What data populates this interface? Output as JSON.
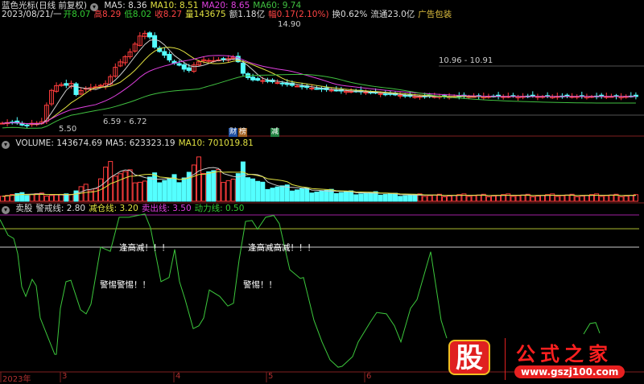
{
  "header": {
    "title": "蓝色光标(日线 前复权)",
    "ma5": "MA5: 8.36",
    "ma10": "MA10: 8.51",
    "ma20": "MA20: 8.65",
    "ma60": "MA60: 9.74",
    "date": "2023/08/21/一",
    "open_l": "开",
    "open": "8.07",
    "high_l": "高",
    "high": "8.29",
    "low_l": "低",
    "low": "8.02",
    "close_l": "收",
    "close": "8.27",
    "vol_l": "量",
    "vol": "143675",
    "amt": "额1.18亿",
    "chg_l": "幅",
    "chg": "0.17(2.10%)",
    "turn": "换0.62%",
    "float": "流通23.0亿",
    "sector": "广告包装"
  },
  "price_labels": {
    "high": "14.90",
    "low": "5.50",
    "range1": "6.59 - 6.72",
    "range2": "10.96 - 10.91"
  },
  "tags": {
    "cai": "财",
    "bang": "榜",
    "jian": "减"
  },
  "volume_header": {
    "vol": "VOLUME: 143674.69",
    "ma5": "MA5: 623323.19",
    "ma10": "MA10: 701019.81"
  },
  "indicator_header": {
    "name": "卖股",
    "warn": "警戒线: 2.80",
    "reduce": "减仓线: 3.20",
    "sell": "卖出线: 3.50",
    "power": "动力线: 0.50"
  },
  "annotations": [
    "逢高减！！！",
    "逢高减高减！！！",
    "警惕警惕！！",
    "警惕！！"
  ],
  "xaxis": [
    "2023年",
    "3",
    "4",
    "5",
    "6"
  ],
  "watermark": {
    "logo": "股",
    "name": "公式之家",
    "url": "www.gszj100.com"
  },
  "colors": {
    "up": "#ff3c3c",
    "down": "#54ffff",
    "ma5": "#cccccc",
    "ma10": "#e0e040",
    "ma20": "#e040e0",
    "ma60": "#40c040",
    "indicator": "#3cc83c"
  },
  "chart_data": {
    "type": "candlestick",
    "price_keypoints": [
      [
        0,
        6.0
      ],
      [
        10,
        6.1
      ],
      [
        20,
        6.0
      ],
      [
        28,
        5.7
      ],
      [
        36,
        6.0
      ],
      [
        48,
        6.0
      ],
      [
        52,
        6.7
      ],
      [
        58,
        8.6
      ],
      [
        64,
        9.3
      ],
      [
        72,
        9.5
      ],
      [
        80,
        9.4
      ],
      [
        86,
        9.6
      ],
      [
        90,
        8.5
      ],
      [
        94,
        8.7
      ],
      [
        100,
        9.1
      ],
      [
        110,
        9.2
      ],
      [
        118,
        9.3
      ],
      [
        130,
        9.6
      ],
      [
        140,
        11.0
      ],
      [
        150,
        11.8
      ],
      [
        160,
        12.5
      ],
      [
        170,
        13.8
      ],
      [
        180,
        14.2
      ],
      [
        190,
        12.7
      ],
      [
        200,
        12.2
      ],
      [
        210,
        11.5
      ],
      [
        220,
        11.2
      ],
      [
        230,
        10.6
      ],
      [
        240,
        11.4
      ],
      [
        250,
        11.7
      ],
      [
        260,
        11.6
      ],
      [
        270,
        11.7
      ],
      [
        280,
        11.8
      ],
      [
        290,
        12.0
      ],
      [
        300,
        10.3
      ],
      [
        310,
        9.9
      ],
      [
        330,
        9.8
      ],
      [
        360,
        9.4
      ],
      [
        390,
        9.1
      ],
      [
        420,
        8.9
      ],
      [
        450,
        8.8
      ],
      [
        480,
        8.6
      ],
      [
        510,
        8.4
      ]
    ],
    "price_range": [
      5.5,
      14.9
    ],
    "volume_keypoints": [
      [
        0,
        200000
      ],
      [
        40,
        220000
      ],
      [
        80,
        180000
      ],
      [
        100,
        450000
      ],
      [
        115,
        400000
      ],
      [
        130,
        1000000
      ],
      [
        145,
        900000
      ],
      [
        160,
        800000
      ],
      [
        175,
        600000
      ],
      [
        190,
        700000
      ],
      [
        210,
        650000
      ],
      [
        230,
        850000
      ],
      [
        245,
        1100000
      ],
      [
        260,
        900000
      ],
      [
        275,
        750000
      ],
      [
        290,
        650000
      ],
      [
        300,
        1000000
      ],
      [
        320,
        500000
      ],
      [
        360,
        380000
      ],
      [
        400,
        300000
      ],
      [
        450,
        250000
      ],
      [
        510,
        180000
      ]
    ],
    "volume_max": 1500000,
    "indicator_levels": {
      "warn": 2.8,
      "reduce": 3.2,
      "sell": 3.5,
      "power": 0.5
    },
    "indicator_points": [
      [
        0,
        3.4
      ],
      [
        10,
        3.06
      ],
      [
        17,
        2.99
      ],
      [
        22,
        2.66
      ],
      [
        27,
        1.94
      ],
      [
        32,
        1.73
      ],
      [
        40,
        2.1
      ],
      [
        45,
        1.96
      ],
      [
        50,
        1.26
      ],
      [
        60,
        0.82
      ],
      [
        68,
        0.47
      ],
      [
        70,
        0.47
      ],
      [
        75,
        1.47
      ],
      [
        82,
        2.05
      ],
      [
        88,
        2.08
      ],
      [
        100,
        1.44
      ],
      [
        107,
        1.35
      ],
      [
        113,
        1.56
      ],
      [
        125,
        2.8
      ],
      [
        137,
        2.71
      ],
      [
        148,
        3.45
      ],
      [
        160,
        3.45
      ],
      [
        180,
        3.52
      ],
      [
        187,
        3.22
      ],
      [
        200,
        2.05
      ],
      [
        210,
        2.14
      ],
      [
        217,
        2.75
      ],
      [
        223,
        2.05
      ],
      [
        230,
        1.66
      ],
      [
        240,
        1.03
      ],
      [
        247,
        1.09
      ],
      [
        253,
        1.26
      ],
      [
        260,
        1.87
      ],
      [
        273,
        1.73
      ],
      [
        283,
        1.52
      ],
      [
        290,
        1.58
      ],
      [
        297,
        2.52
      ],
      [
        305,
        3.36
      ],
      [
        313,
        3.38
      ],
      [
        320,
        3.19
      ],
      [
        330,
        3.45
      ],
      [
        340,
        3.49
      ],
      [
        347,
        3.31
      ],
      [
        360,
        2.31
      ],
      [
        373,
        2.12
      ],
      [
        377,
        2.14
      ],
      [
        390,
        1.21
      ],
      [
        400,
        0.74
      ],
      [
        410,
        0.35
      ],
      [
        420,
        0.19
      ],
      [
        425,
        0.21
      ],
      [
        438,
        0.42
      ],
      [
        445,
        0.74
      ],
      [
        460,
        1.17
      ],
      [
        468,
        1.38
      ],
      [
        480,
        1.35
      ],
      [
        490,
        1.09
      ],
      [
        498,
        0.74
      ],
      [
        510,
        1.47
      ],
      [
        518,
        1.66
      ],
      [
        535,
        2.7
      ],
      [
        548,
        1.21
      ],
      [
        555,
        0.82
      ]
    ],
    "indicator_tail": [
      [
        725,
        0.91
      ],
      [
        733,
        1.14
      ],
      [
        740,
        1.16
      ],
      [
        745,
        0.93
      ]
    ]
  }
}
